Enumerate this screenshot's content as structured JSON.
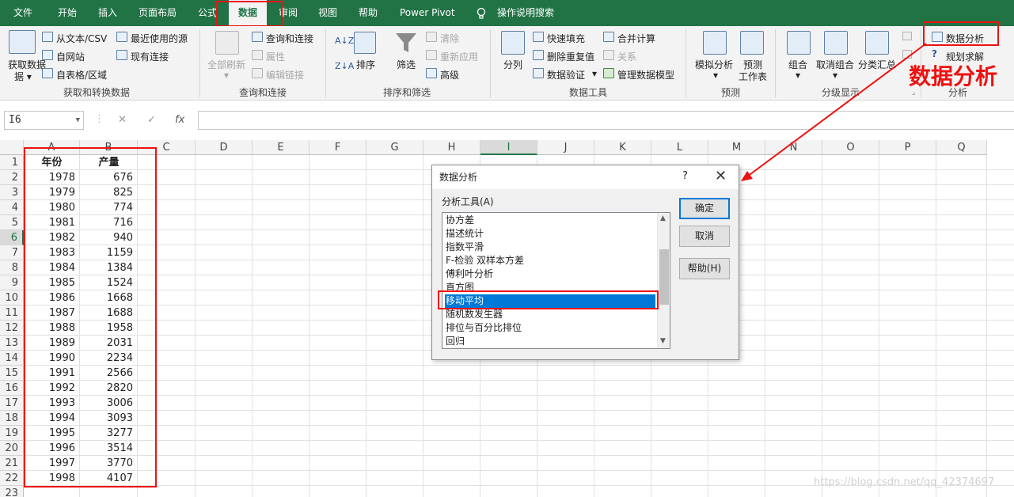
{
  "tabs": [
    "文件",
    "开始",
    "插入",
    "页面布局",
    "公式",
    "数据",
    "审阅",
    "视图",
    "帮助",
    "Power Pivot"
  ],
  "tell_me": "操作说明搜索",
  "ribbon": {
    "get_data": "获取数据",
    "from_text": "从文本/CSV",
    "from_web": "自网站",
    "from_table": "自表格/区域",
    "recent_sources": "最近使用的源",
    "existing_conn": "现有连接",
    "group1": "获取和转换数据",
    "refresh_all": "全部刷新",
    "queries_conn": "查询和连接",
    "properties": "属性",
    "edit_links": "编辑链接",
    "group2": "查询和连接",
    "sort": "排序",
    "filter": "筛选",
    "clear": "清除",
    "reapply": "重新应用",
    "advanced": "高级",
    "group3": "排序和筛选",
    "split": "分列",
    "flash_fill": "快速填充",
    "remove_dup": "删除重复值",
    "validation": "数据验证",
    "consolidate": "合并计算",
    "relations": "关系",
    "data_model": "管理数据模型",
    "group4": "数据工具",
    "whatif": "模拟分析",
    "forecast1": "预测",
    "forecast2": "工作表",
    "group5": "预测",
    "group_btn": "组合",
    "ungroup": "取消组合",
    "subtotal": "分类汇总",
    "group6": "分级显示",
    "data_analysis": "数据分析",
    "solver": "规划求解",
    "group7": "分析"
  },
  "annotation": "数据分析",
  "namebox": "I6",
  "formula_icons": {
    "cancel": "✕",
    "enter": "✓",
    "fx": "fx"
  },
  "columns": [
    "A",
    "B",
    "C",
    "D",
    "E",
    "F",
    "G",
    "H",
    "I",
    "J",
    "K",
    "L",
    "M",
    "N",
    "O",
    "P",
    "Q"
  ],
  "rows": [
    "1",
    "2",
    "3",
    "4",
    "5",
    "6",
    "7",
    "8",
    "9",
    "10",
    "11",
    "12",
    "13",
    "14",
    "15",
    "16",
    "17",
    "18",
    "19",
    "20",
    "21",
    "22",
    "23"
  ],
  "table": {
    "header_year": "年份",
    "header_output": "产量",
    "years": [
      "1978",
      "1979",
      "1980",
      "1981",
      "1982",
      "1983",
      "1984",
      "1985",
      "1986",
      "1987",
      "1988",
      "1989",
      "1990",
      "1991",
      "1992",
      "1993",
      "1994",
      "1995",
      "1996",
      "1997",
      "1998"
    ],
    "outputs": [
      "676",
      "825",
      "774",
      "716",
      "940",
      "1159",
      "1384",
      "1524",
      "1668",
      "1688",
      "1958",
      "2031",
      "2234",
      "2566",
      "2820",
      "3006",
      "3093",
      "3277",
      "3514",
      "3770",
      "4107"
    ]
  },
  "dialog": {
    "title": "数据分析",
    "help_q": "?",
    "close": "✕",
    "list_label": "分析工具(A)",
    "items": [
      "协方差",
      "描述统计",
      "指数平滑",
      "F-检验 双样本方差",
      "傅利叶分析",
      "直方图",
      "移动平均",
      "随机数发生器",
      "排位与百分比排位",
      "回归"
    ],
    "selected_index": 6,
    "ok": "确定",
    "cancel": "取消",
    "help": "帮助(H)"
  },
  "watermark": "https://blog.csdn.net/qq_42374697"
}
